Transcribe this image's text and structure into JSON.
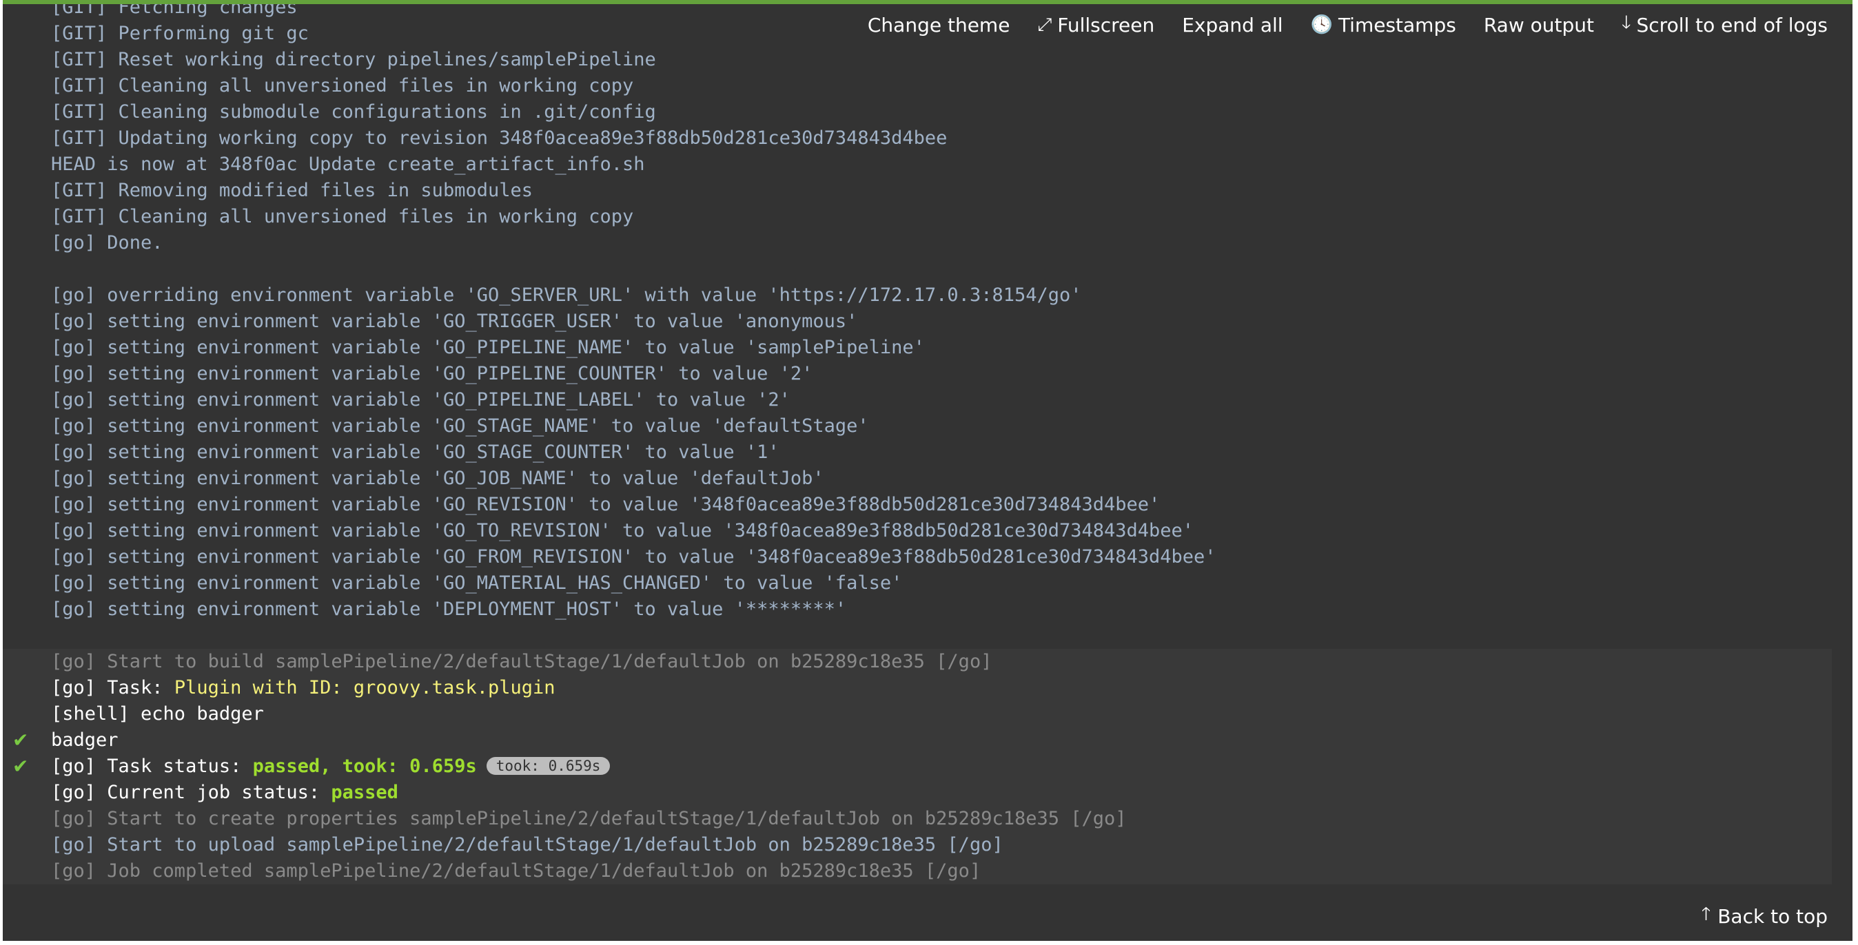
{
  "toolbar": {
    "change_theme": "Change theme",
    "fullscreen": "Fullscreen",
    "expand_all": "Expand all",
    "timestamps": "Timestamps",
    "raw_output": "Raw output",
    "scroll_end": "Scroll to end of logs"
  },
  "log": {
    "git_lines": [
      "[GIT] Fetching changes",
      "[GIT] Performing git gc",
      "[GIT] Reset working directory pipelines/samplePipeline",
      "[GIT] Cleaning all unversioned files in working copy",
      "[GIT] Cleaning submodule configurations in .git/config",
      "[GIT] Updating working copy to revision 348f0acea89e3f88db50d281ce30d734843d4bee",
      "HEAD is now at 348f0ac Update create_artifact_info.sh",
      "[GIT] Removing modified files in submodules",
      "[GIT] Cleaning all unversioned files in working copy",
      "[go] Done."
    ],
    "env_lines": [
      "[go] overriding environment variable 'GO_SERVER_URL' with value 'https://172.17.0.3:8154/go'",
      "[go] setting environment variable 'GO_TRIGGER_USER' to value 'anonymous'",
      "[go] setting environment variable 'GO_PIPELINE_NAME' to value 'samplePipeline'",
      "[go] setting environment variable 'GO_PIPELINE_COUNTER' to value '2'",
      "[go] setting environment variable 'GO_PIPELINE_LABEL' to value '2'",
      "[go] setting environment variable 'GO_STAGE_NAME' to value 'defaultStage'",
      "[go] setting environment variable 'GO_STAGE_COUNTER' to value '1'",
      "[go] setting environment variable 'GO_JOB_NAME' to value 'defaultJob'",
      "[go] setting environment variable 'GO_REVISION' to value '348f0acea89e3f88db50d281ce30d734843d4bee'",
      "[go] setting environment variable 'GO_TO_REVISION' to value '348f0acea89e3f88db50d281ce30d734843d4bee'",
      "[go] setting environment variable 'GO_FROM_REVISION' to value '348f0acea89e3f88db50d281ce30d734843d4bee'",
      "[go] setting environment variable 'GO_MATERIAL_HAS_CHANGED' to value 'false'",
      "[go] setting environment variable 'DEPLOYMENT_HOST' to value '********'"
    ],
    "start_build": "[go] Start to build samplePipeline/2/defaultStage/1/defaultJob on b25289c18e35 [/go]",
    "task_prefix": "[go] Task: ",
    "task_name": "Plugin with ID: groovy.task.plugin",
    "shell_cmd": "[shell] echo badger",
    "output": "badger",
    "task_status_prefix": "[go] Task status: ",
    "task_status_value": "passed, took: 0.659s",
    "took_badge": "took: 0.659s",
    "job_status_prefix": "[go] Current job status: ",
    "job_status_value": "passed",
    "create_props": "[go] Start to create properties samplePipeline/2/defaultStage/1/defaultJob on b25289c18e35 [/go]",
    "upload": "[go] Start to upload samplePipeline/2/defaultStage/1/defaultJob on b25289c18e35 [/go]",
    "completed": "[go] Job completed samplePipeline/2/defaultStage/1/defaultJob on b25289c18e35 [/go]"
  },
  "footer": {
    "back_to_top": "Back to top"
  },
  "colors": {
    "accent_bar": "#64a23c",
    "background": "#333333",
    "log_text": "#a0b2c7",
    "task_yellow": "#f5f07a",
    "status_green": "#9fde2f"
  }
}
